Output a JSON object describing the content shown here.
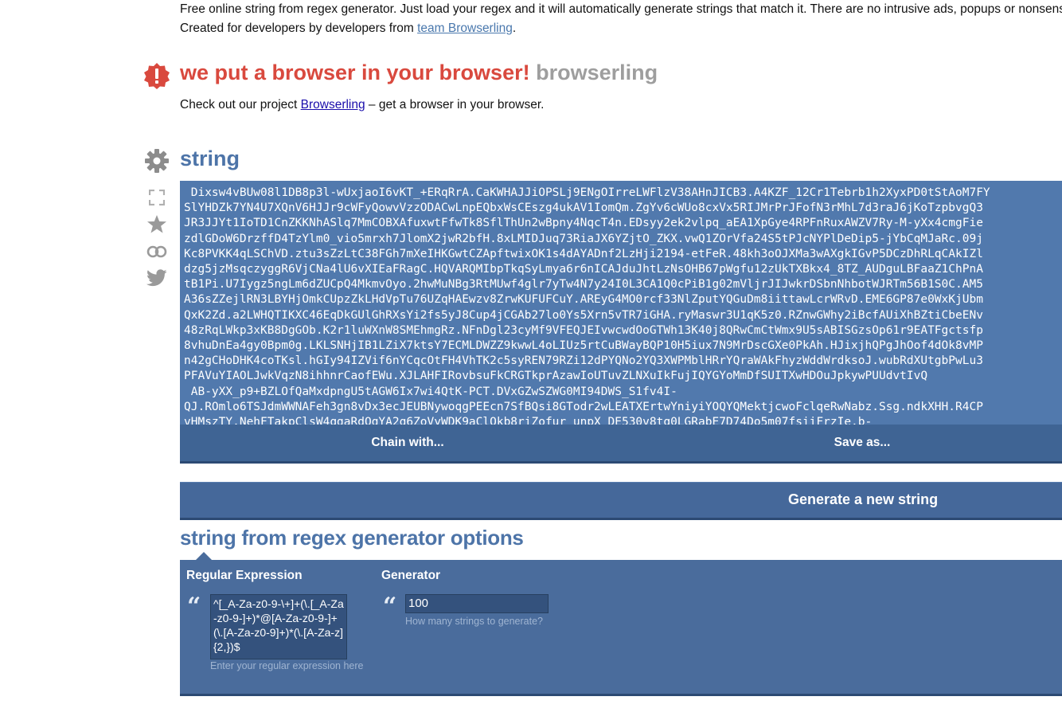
{
  "intro": {
    "line1": "Free online string from regex generator. Just load your regex and it will automatically generate strings that match it. There are no intrusive ads, popups or nonsense, just a string from regex generator. Load a regex, get strings.",
    "line2_prefix": "Created for developers by developers from ",
    "line2_link": "team Browserling",
    "line2_suffix": "."
  },
  "promo": {
    "title_red": "we put a browser in your browser!",
    "title_grey": "browserling",
    "text_prefix": "Check out our project ",
    "text_link": "Browserling",
    "text_suffix": " – get a browser in your browser."
  },
  "icons": {
    "alert": "exclamation-badge-icon",
    "settings": "gear-icon",
    "fullscreen": "fullscreen-icon",
    "favorite": "star-icon",
    "link": "link-icon",
    "twitter": "twitter-icon"
  },
  "colors": {
    "accent": "#4d74a8",
    "output_bg": "#5179ad",
    "bar_bg": "#3f6494",
    "alert_red": "#d9493e"
  },
  "string_section": {
    "heading": "string",
    "output": " Dixsw4vBUw08l1DB8p3l-wUxjaoI6vKT_+ERqRrA.CaKWHAJJiOPSLj9ENgOIrreLWFlzV38AHnJICB3.A4KZF_12Cr1Tebrb1h2XyxPD0tStAoM7FY\nSlYHDZk7YN4U7XQnV6HJJr9cWFyQowvVzzODACwLnpEQbxWsCEszg4ukAV1IomQm.ZgYv6cWUo8cxVx5RIJMrPrJFofN3rMhL7d3raJ6jKoTzpbvgQ3\nJR3JJYt1IoTD1CnZKKNhASlq7MmCOBXAfuxwtFfwTk8SflThUn2wBpny4NqcT4n.EDsyy2ek2vlpq_aEA1XpGye4RPFnRuxAWZV7Ry-M-yXx4cmgFie\nzdlGDoW6DrzffD4TzYlm0_vio5mrxh7JlomX2jwR2bfH.8xLMIDJuq73RiaJX6YZjtO_ZKX.vwQ1ZOrVfa24S5tPJcNYPlDeDip5-jYbCqMJaRc.09j\nKc8PVKK4qLSChVD.ztu3sZzLtC38FGh7mXeIHKGwtCZApftwixOK1s4dAYADnf2LzHji2194-etFeR.48kh3oOJXMa3wAXgkIGvP5DCzDhRLqCAkIZl\ndzg5jzMsqczyggR6VjCNa4lU6vXIEaFRagC.HQVARQMIbpTkqSyLmya6r6nICAJduJhtLzNsOHB67pWgfu12zUkTXBkx4_8TZ_AUDguLBFaaZ1ChPnA\ntB1Pi.U7Iygz5ngLm6dZUCpQ4MkmvOyo.2hwMuNBg3RtMUwf4glr7yTw4N7y24I0L3CA1Q0cPiB1g02mVljrJIJwkrDSbnNhbotWJRTm56B1S0C.AM5\nA36sZZejlRN3LBYHjOmkCUpzZkLHdVpTu76UZqHAEwzv8ZrwKUFUFCuY.AREyG4MO0rcf33NlZputYQGuDm8iittawLcrWRvD.EME6GP87e0WxKjUbm\nQxK2Zd.a2LWHQTIKXC46EqDkGUlGhRXsYi2fs5yJ8Cup4jCGAb27lo0Ys5Xrn5vTR7iGHA.ryMaswr3U1qK5z0.RZnwGWhy2iBcfAUiXhBZtiCbeENv\n48zRqLWkp3xKB8DgGOb.K2r1luWXnW8SMEhmgRz.NFnDgl23cyMf9VFEQJEIvwcwdOoGTWh13K40j8QRwCmCtWmx9U5sABISGzsOp61r9EATFgctsfp\n8vhuDnEa4gy0Bpm0g.LKLSNHjIB1LZiX7ktsY7ECMLDWZZ9kwwL4oLIUz5rtCuBWayBQP10H5iux7N9MrDscGXe0PkAh.HJixjhQPgJhOof4dOk8vMP\nn42gCHoDHK4coTKsl.hGIy94IZVif6nYCqcOtFH4VhTK2c5syREN79RZi12dPYQNo2YQ3XWPMblHRrYQraWAkFhyzWddWrdksoJ.wubRdXUtgbPwLu3\nPFAVuYIAOLJwkVqzN8ihhnrCaofEWu.XJLAHFIRovbsuFkCRGTkprAzawIoUTuvZLNXuIkFujIQYGYoMmDfSUITXwHDOuJpkywPUUdvtIvQ\n AB-yXX_p9+BZLOfQaMxdpngU5tAGW6Ix7wi4QtK-PCT.DVxGZwSZWG0MI94DWS_S1fv4I-\nQJ.ROmlo6TSJdmWWNAFeh3gn8vDx3ecJEUBNywoqgPEEcn7SfBQsi8GTodr2wLEATXErtwYniyiYOQYQMektjcwoFclqeRwNabz.Ssg.ndkXHH.R4CP\nvHMszTY.NehFTakpClsW4qgaRdOgYA2q6ZoVyWDK9aClQkb8riZofur_unpX_DE530v8tq0LGRabE7D74Do5m07fsiiFrzIe.b-"
  },
  "actions": {
    "chain": "Chain with...",
    "save": "Save as...",
    "generate": "Generate a new string"
  },
  "options": {
    "heading": "string from regex generator options",
    "regex_label": "Regular Expression",
    "regex_value": "^[_A-Za-z0-9-\\+]+(\\.[_A-Za-z0-9-]+)*@[A-Za-z0-9-]+(\\.[A-Za-z0-9]+)*(\\.[A-Za-z]{2,})$",
    "regex_help": "Enter your regular expression here",
    "gen_label": "Generator",
    "gen_value": "100",
    "gen_help": "How many strings to generate?"
  }
}
